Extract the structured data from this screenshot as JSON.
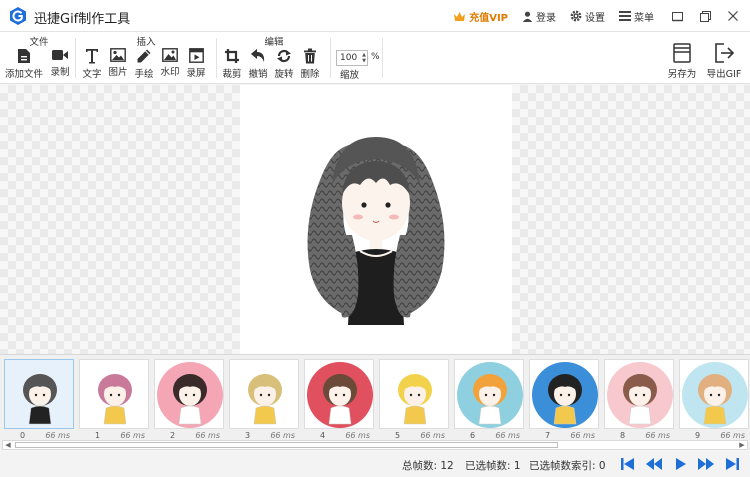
{
  "window": {
    "title": "迅捷Gif制作工具",
    "vip_label": "充值VIP",
    "login_label": "登录",
    "settings_label": "设置",
    "menu_label": "菜单"
  },
  "toolbar": {
    "groups": {
      "file": "文件",
      "insert": "插入",
      "edit": "编辑"
    },
    "add_file": "添加文件",
    "record": "录制",
    "text": "文字",
    "image": "图片",
    "handdraw": "手绘",
    "watermark": "水印",
    "screen_record": "录屏",
    "crop": "裁剪",
    "undo": "撤销",
    "rotate": "旋转",
    "delete": "删除",
    "zoom_value": "100",
    "zoom_unit": "%",
    "zoom_label": "缩放",
    "save_as": "另存为",
    "export_gif": "导出GIF"
  },
  "frames": [
    {
      "index": "0",
      "duration": "66 ms",
      "hair": "#555555",
      "bg": "#ffffff",
      "selected": true
    },
    {
      "index": "1",
      "duration": "66 ms",
      "hair": "#c97a9a",
      "bg": "#ffffff",
      "selected": false
    },
    {
      "index": "2",
      "duration": "66 ms",
      "hair": "#3a2a2a",
      "bg": "#f4a6b4",
      "selected": false
    },
    {
      "index": "3",
      "duration": "66 ms",
      "hair": "#d8c07a",
      "bg": "#ffffff",
      "selected": false
    },
    {
      "index": "4",
      "duration": "66 ms",
      "hair": "#6b4a3a",
      "bg": "#e0505e",
      "selected": false
    },
    {
      "index": "5",
      "duration": "66 ms",
      "hair": "#f2d24a",
      "bg": "#ffffff",
      "selected": false
    },
    {
      "index": "6",
      "duration": "66 ms",
      "hair": "#f2a23a",
      "bg": "#8fd0e0",
      "selected": false
    },
    {
      "index": "7",
      "duration": "66 ms",
      "hair": "#222222",
      "bg": "#3a8fd8",
      "selected": false
    },
    {
      "index": "8",
      "duration": "66 ms",
      "hair": "#8a5a4a",
      "bg": "#f7c9cf",
      "selected": false
    },
    {
      "index": "9",
      "duration": "66 ms",
      "hair": "#e2b080",
      "bg": "#bfe6f0",
      "selected": false
    }
  ],
  "status": {
    "total_frames": "总帧数: 12",
    "selected_frames": "已选帧数: 1",
    "selected_index": "已选帧数索引: 0"
  },
  "colors": {
    "accent": "#1e6fd9",
    "vip": "#e07b00"
  }
}
